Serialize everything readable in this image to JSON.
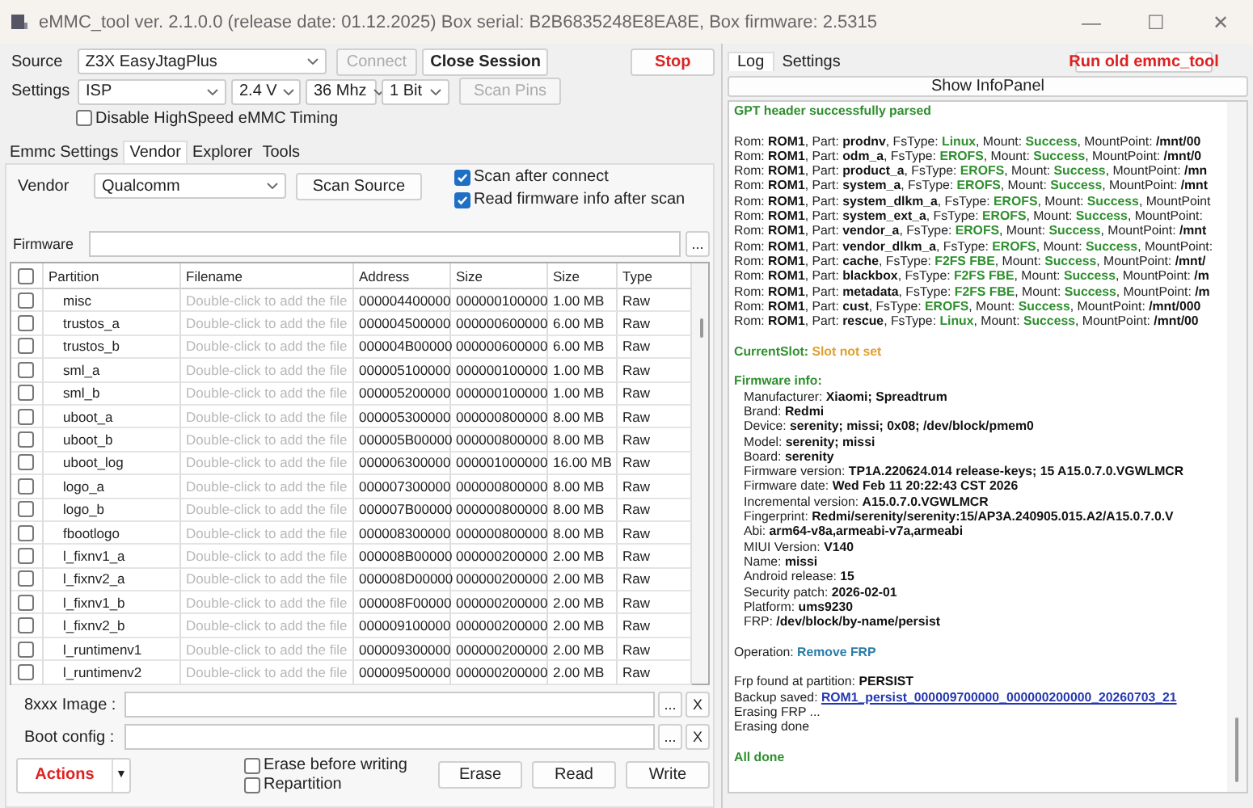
{
  "window": {
    "title": "eMMC_tool ver. 2.1.0.0 (release date: 01.12.2025) Box serial: B2B6835248E8EA8E, Box firmware: 2.5315",
    "controls": [
      "—",
      "☐",
      "✕"
    ]
  },
  "source": {
    "label": "Source",
    "value": "Z3X EasyJtagPlus",
    "connect": {
      "label": "Connect",
      "disabled": true
    },
    "close_session": "Close Session",
    "stop": "Stop"
  },
  "settings": {
    "label": "Settings",
    "interface": "ISP",
    "voltage": "2.4 V",
    "clock": "36 Mhz",
    "bus": "1 Bit",
    "scan_pins": {
      "label": "Scan Pins",
      "disabled": true
    }
  },
  "disable_highspeed": {
    "label": "Disable HighSpeed eMMC Timing",
    "checked": false
  },
  "tabs": [
    {
      "label": "Emmc Settings",
      "selected": false
    },
    {
      "label": "Vendor",
      "selected": true
    },
    {
      "label": "Explorer",
      "selected": false
    },
    {
      "label": "Tools",
      "selected": false
    }
  ],
  "vendor": {
    "label": "Vendor",
    "value": "Qualcomm",
    "scan_source": "Scan Source",
    "options": [
      {
        "label": "Scan after connect",
        "checked": true
      },
      {
        "label": "Read firmware info after scan",
        "checked": true
      }
    ]
  },
  "firmware": {
    "label": "Firmware",
    "browse": "..."
  },
  "table": {
    "header_checked": false,
    "columns": [
      "Partition",
      "Filename",
      "Address",
      "Size",
      "Size",
      "Type"
    ],
    "rows": [
      {
        "checked": false,
        "partition": "misc",
        "filename": "Double-click to add the file",
        "address": "000004400000",
        "size": "000000100000",
        "size_mb": "1.00 MB",
        "type": "Raw"
      },
      {
        "checked": false,
        "partition": "trustos_a",
        "filename": "Double-click to add the file",
        "address": "000004500000",
        "size": "000000600000",
        "size_mb": "6.00 MB",
        "type": "Raw"
      },
      {
        "checked": false,
        "partition": "trustos_b",
        "filename": "Double-click to add the file",
        "address": "000004B00000",
        "size": "000000600000",
        "size_mb": "6.00 MB",
        "type": "Raw"
      },
      {
        "checked": false,
        "partition": "sml_a",
        "filename": "Double-click to add the file",
        "address": "000005100000",
        "size": "000000100000",
        "size_mb": "1.00 MB",
        "type": "Raw"
      },
      {
        "checked": false,
        "partition": "sml_b",
        "filename": "Double-click to add the file",
        "address": "000005200000",
        "size": "000000100000",
        "size_mb": "1.00 MB",
        "type": "Raw"
      },
      {
        "checked": false,
        "partition": "uboot_a",
        "filename": "Double-click to add the file",
        "address": "000005300000",
        "size": "000000800000",
        "size_mb": "8.00 MB",
        "type": "Raw"
      },
      {
        "checked": false,
        "partition": "uboot_b",
        "filename": "Double-click to add the file",
        "address": "000005B00000",
        "size": "000000800000",
        "size_mb": "8.00 MB",
        "type": "Raw"
      },
      {
        "checked": false,
        "partition": "uboot_log",
        "filename": "Double-click to add the file",
        "address": "000006300000",
        "size": "000001000000",
        "size_mb": "16.00 MB",
        "type": "Raw"
      },
      {
        "checked": false,
        "partition": "logo_a",
        "filename": "Double-click to add the file",
        "address": "000007300000",
        "size": "000000800000",
        "size_mb": "8.00 MB",
        "type": "Raw"
      },
      {
        "checked": false,
        "partition": "logo_b",
        "filename": "Double-click to add the file",
        "address": "000007B00000",
        "size": "000000800000",
        "size_mb": "8.00 MB",
        "type": "Raw"
      },
      {
        "checked": false,
        "partition": "fbootlogo",
        "filename": "Double-click to add the file",
        "address": "000008300000",
        "size": "000000800000",
        "size_mb": "8.00 MB",
        "type": "Raw"
      },
      {
        "checked": false,
        "partition": "l_fixnv1_a",
        "filename": "Double-click to add the file",
        "address": "000008B00000",
        "size": "000000200000",
        "size_mb": "2.00 MB",
        "type": "Raw"
      },
      {
        "checked": false,
        "partition": "l_fixnv2_a",
        "filename": "Double-click to add the file",
        "address": "000008D00000",
        "size": "000000200000",
        "size_mb": "2.00 MB",
        "type": "Raw"
      },
      {
        "checked": false,
        "partition": "l_fixnv1_b",
        "filename": "Double-click to add the file",
        "address": "000008F00000",
        "size": "000000200000",
        "size_mb": "2.00 MB",
        "type": "Raw"
      },
      {
        "checked": false,
        "partition": "l_fixnv2_b",
        "filename": "Double-click to add the file",
        "address": "000009100000",
        "size": "000000200000",
        "size_mb": "2.00 MB",
        "type": "Raw"
      },
      {
        "checked": false,
        "partition": "l_runtimenv1",
        "filename": "Double-click to add the file",
        "address": "000009300000",
        "size": "000000200000",
        "size_mb": "2.00 MB",
        "type": "Raw"
      },
      {
        "checked": false,
        "partition": "l_runtimenv2",
        "filename": "Double-click to add the file",
        "address": "000009500000",
        "size": "000000200000",
        "size_mb": "2.00 MB",
        "type": "Raw"
      }
    ]
  },
  "image_fields": [
    {
      "label": "8xxx Image :",
      "browse": "...",
      "clear": "X"
    },
    {
      "label": "Boot config :",
      "browse": "...",
      "clear": "X"
    }
  ],
  "actions": {
    "label": "Actions",
    "menu": "▼",
    "options": [
      {
        "label": "Erase before writing",
        "checked": false
      },
      {
        "label": "Repartition",
        "checked": false
      }
    ],
    "buttons": [
      "Erase",
      "Read",
      "Write"
    ]
  },
  "right_tabs": [
    {
      "label": "Log",
      "selected": true
    },
    {
      "label": "Settings",
      "selected": false
    }
  ],
  "run_old": "Run old emmc_tool",
  "show_infopanel": "Show InfoPanel",
  "log": [
    {
      "kind": "line",
      "parts": [
        {
          "kind": "status",
          "text": "GPT header successfully parsed"
        }
      ]
    },
    {
      "kind": "gap"
    },
    {
      "kind": "line",
      "parts": [
        {
          "kind": "text",
          "text": "Rom: "
        },
        {
          "kind": "value",
          "text": "ROM1"
        },
        {
          "kind": "text",
          "text": ", Part: "
        },
        {
          "kind": "value",
          "text": "prodnv"
        },
        {
          "kind": "text",
          "text": ", FsType: "
        },
        {
          "kind": "status",
          "text": "Linux"
        },
        {
          "kind": "text",
          "text": ", Mount: "
        },
        {
          "kind": "status",
          "text": "Success"
        },
        {
          "kind": "text",
          "text": ", MountPoint: "
        },
        {
          "kind": "value",
          "text": "/mnt/00"
        }
      ]
    },
    {
      "kind": "line",
      "parts": [
        {
          "kind": "text",
          "text": "Rom: "
        },
        {
          "kind": "value",
          "text": "ROM1"
        },
        {
          "kind": "text",
          "text": ", Part: "
        },
        {
          "kind": "value",
          "text": "odm_a"
        },
        {
          "kind": "text",
          "text": ", FsType: "
        },
        {
          "kind": "status",
          "text": "EROFS"
        },
        {
          "kind": "text",
          "text": ", Mount: "
        },
        {
          "kind": "status",
          "text": "Success"
        },
        {
          "kind": "text",
          "text": ", MountPoint: "
        },
        {
          "kind": "value",
          "text": "/mnt/0"
        }
      ]
    },
    {
      "kind": "line",
      "parts": [
        {
          "kind": "text",
          "text": "Rom: "
        },
        {
          "kind": "value",
          "text": "ROM1"
        },
        {
          "kind": "text",
          "text": ", Part: "
        },
        {
          "kind": "value",
          "text": "product_a"
        },
        {
          "kind": "text",
          "text": ", FsType: "
        },
        {
          "kind": "status",
          "text": "EROFS"
        },
        {
          "kind": "text",
          "text": ", Mount: "
        },
        {
          "kind": "status",
          "text": "Success"
        },
        {
          "kind": "text",
          "text": ", MountPoint: "
        },
        {
          "kind": "value",
          "text": "/mn"
        }
      ]
    },
    {
      "kind": "line",
      "parts": [
        {
          "kind": "text",
          "text": "Rom: "
        },
        {
          "kind": "value",
          "text": "ROM1"
        },
        {
          "kind": "text",
          "text": ", Part: "
        },
        {
          "kind": "value",
          "text": "system_a"
        },
        {
          "kind": "text",
          "text": ", FsType: "
        },
        {
          "kind": "status",
          "text": "EROFS"
        },
        {
          "kind": "text",
          "text": ", Mount: "
        },
        {
          "kind": "status",
          "text": "Success"
        },
        {
          "kind": "text",
          "text": ", MountPoint: "
        },
        {
          "kind": "value",
          "text": "/mnt"
        }
      ]
    },
    {
      "kind": "line",
      "parts": [
        {
          "kind": "text",
          "text": "Rom: "
        },
        {
          "kind": "value",
          "text": "ROM1"
        },
        {
          "kind": "text",
          "text": ", Part: "
        },
        {
          "kind": "value",
          "text": "system_dlkm_a"
        },
        {
          "kind": "text",
          "text": ", FsType: "
        },
        {
          "kind": "status",
          "text": "EROFS"
        },
        {
          "kind": "text",
          "text": ", Mount: "
        },
        {
          "kind": "status",
          "text": "Success"
        },
        {
          "kind": "text",
          "text": ", MountPoint"
        }
      ]
    },
    {
      "kind": "line",
      "parts": [
        {
          "kind": "text",
          "text": "Rom: "
        },
        {
          "kind": "value",
          "text": "ROM1"
        },
        {
          "kind": "text",
          "text": ", Part: "
        },
        {
          "kind": "value",
          "text": "system_ext_a"
        },
        {
          "kind": "text",
          "text": ", FsType: "
        },
        {
          "kind": "status",
          "text": "EROFS"
        },
        {
          "kind": "text",
          "text": ", Mount: "
        },
        {
          "kind": "status",
          "text": "Success"
        },
        {
          "kind": "text",
          "text": ", MountPoint:"
        }
      ]
    },
    {
      "kind": "line",
      "parts": [
        {
          "kind": "text",
          "text": "Rom: "
        },
        {
          "kind": "value",
          "text": "ROM1"
        },
        {
          "kind": "text",
          "text": ", Part: "
        },
        {
          "kind": "value",
          "text": "vendor_a"
        },
        {
          "kind": "text",
          "text": ", FsType: "
        },
        {
          "kind": "status",
          "text": "EROFS"
        },
        {
          "kind": "text",
          "text": ", Mount: "
        },
        {
          "kind": "status",
          "text": "Success"
        },
        {
          "kind": "text",
          "text": ", MountPoint: "
        },
        {
          "kind": "value",
          "text": "/mnt"
        }
      ]
    },
    {
      "kind": "line",
      "parts": [
        {
          "kind": "text",
          "text": "Rom: "
        },
        {
          "kind": "value",
          "text": "ROM1"
        },
        {
          "kind": "text",
          "text": ", Part: "
        },
        {
          "kind": "value",
          "text": "vendor_dlkm_a"
        },
        {
          "kind": "text",
          "text": ", FsType: "
        },
        {
          "kind": "status",
          "text": "EROFS"
        },
        {
          "kind": "text",
          "text": ", Mount: "
        },
        {
          "kind": "status",
          "text": "Success"
        },
        {
          "kind": "text",
          "text": ", MountPoint:"
        }
      ]
    },
    {
      "kind": "line",
      "parts": [
        {
          "kind": "text",
          "text": "Rom: "
        },
        {
          "kind": "value",
          "text": "ROM1"
        },
        {
          "kind": "text",
          "text": ", Part: "
        },
        {
          "kind": "value",
          "text": "cache"
        },
        {
          "kind": "text",
          "text": ", FsType: "
        },
        {
          "kind": "status",
          "text": "F2FS FBE"
        },
        {
          "kind": "text",
          "text": ", Mount: "
        },
        {
          "kind": "status",
          "text": "Success"
        },
        {
          "kind": "text",
          "text": ", MountPoint: "
        },
        {
          "kind": "value",
          "text": "/mnt/"
        }
      ]
    },
    {
      "kind": "line",
      "parts": [
        {
          "kind": "text",
          "text": "Rom: "
        },
        {
          "kind": "value",
          "text": "ROM1"
        },
        {
          "kind": "text",
          "text": ", Part: "
        },
        {
          "kind": "value",
          "text": "blackbox"
        },
        {
          "kind": "text",
          "text": ", FsType: "
        },
        {
          "kind": "status",
          "text": "F2FS FBE"
        },
        {
          "kind": "text",
          "text": ", Mount: "
        },
        {
          "kind": "status",
          "text": "Success"
        },
        {
          "kind": "text",
          "text": ", MountPoint: "
        },
        {
          "kind": "value",
          "text": "/m"
        }
      ]
    },
    {
      "kind": "line",
      "parts": [
        {
          "kind": "text",
          "text": "Rom: "
        },
        {
          "kind": "value",
          "text": "ROM1"
        },
        {
          "kind": "text",
          "text": ", Part: "
        },
        {
          "kind": "value",
          "text": "metadata"
        },
        {
          "kind": "text",
          "text": ", FsType: "
        },
        {
          "kind": "status",
          "text": "F2FS FBE"
        },
        {
          "kind": "text",
          "text": ", Mount: "
        },
        {
          "kind": "status",
          "text": "Success"
        },
        {
          "kind": "text",
          "text": ", MountPoint: "
        },
        {
          "kind": "value",
          "text": "/m"
        }
      ]
    },
    {
      "kind": "line",
      "parts": [
        {
          "kind": "text",
          "text": "Rom: "
        },
        {
          "kind": "value",
          "text": "ROM1"
        },
        {
          "kind": "text",
          "text": ", Part: "
        },
        {
          "kind": "value",
          "text": "cust"
        },
        {
          "kind": "text",
          "text": ", FsType: "
        },
        {
          "kind": "status",
          "text": "EROFS"
        },
        {
          "kind": "text",
          "text": ", Mount: "
        },
        {
          "kind": "status",
          "text": "Success"
        },
        {
          "kind": "text",
          "text": ", MountPoint: "
        },
        {
          "kind": "value",
          "text": "/mnt/000"
        }
      ]
    },
    {
      "kind": "line",
      "parts": [
        {
          "kind": "text",
          "text": "Rom: "
        },
        {
          "kind": "value",
          "text": "ROM1"
        },
        {
          "kind": "text",
          "text": ", Part: "
        },
        {
          "kind": "value",
          "text": "rescue"
        },
        {
          "kind": "text",
          "text": ", FsType: "
        },
        {
          "kind": "status",
          "text": "Linux"
        },
        {
          "kind": "text",
          "text": ", Mount: "
        },
        {
          "kind": "status",
          "text": "Success"
        },
        {
          "kind": "text",
          "text": ", MountPoint: "
        },
        {
          "kind": "value",
          "text": "/mnt/00"
        }
      ]
    },
    {
      "kind": "gap"
    },
    {
      "kind": "line",
      "parts": [
        {
          "kind": "status",
          "text": "CurrentSlot: "
        },
        {
          "kind": "warning",
          "text": "Slot not set"
        }
      ]
    },
    {
      "kind": "gap"
    },
    {
      "kind": "line",
      "parts": [
        {
          "kind": "status",
          "text": "Firmware info:"
        }
      ]
    },
    {
      "kind": "detail",
      "parts": [
        {
          "kind": "text",
          "text": "Manufacturer: "
        },
        {
          "kind": "value",
          "text": "Xiaomi;  Spreadtrum"
        }
      ]
    },
    {
      "kind": "detail",
      "parts": [
        {
          "kind": "text",
          "text": "Brand: "
        },
        {
          "kind": "value",
          "text": "Redmi"
        }
      ]
    },
    {
      "kind": "detail",
      "parts": [
        {
          "kind": "text",
          "text": "Device: "
        },
        {
          "kind": "value",
          "text": "serenity;  missi;  0x08;  /dev/block/pmem0"
        }
      ]
    },
    {
      "kind": "detail",
      "parts": [
        {
          "kind": "text",
          "text": "Model: "
        },
        {
          "kind": "value",
          "text": "serenity;  missi"
        }
      ]
    },
    {
      "kind": "detail",
      "parts": [
        {
          "kind": "text",
          "text": "Board: "
        },
        {
          "kind": "value",
          "text": "serenity"
        }
      ]
    },
    {
      "kind": "detail",
      "parts": [
        {
          "kind": "text",
          "text": "Firmware version: "
        },
        {
          "kind": "value",
          "text": "TP1A.220624.014 release-keys;  15 A15.0.7.0.VGWLMCR"
        }
      ]
    },
    {
      "kind": "detail",
      "parts": [
        {
          "kind": "text",
          "text": "Firmware date: "
        },
        {
          "kind": "value",
          "text": "Wed Feb 11 20:22:43 CST 2026"
        }
      ]
    },
    {
      "kind": "detail",
      "parts": [
        {
          "kind": "text",
          "text": "Incremental version: "
        },
        {
          "kind": "value",
          "text": "A15.0.7.0.VGWLMCR"
        }
      ]
    },
    {
      "kind": "detail",
      "parts": [
        {
          "kind": "text",
          "text": "Fingerprint: "
        },
        {
          "kind": "value",
          "text": "Redmi/serenity/serenity:15/AP3A.240905.015.A2/A15.0.7.0.V"
        }
      ]
    },
    {
      "kind": "detail",
      "parts": [
        {
          "kind": "text",
          "text": "Abi: "
        },
        {
          "kind": "value",
          "text": "arm64-v8a,armeabi-v7a,armeabi"
        }
      ]
    },
    {
      "kind": "detail",
      "parts": [
        {
          "kind": "text",
          "text": "MIUI Version: "
        },
        {
          "kind": "value",
          "text": "V140"
        }
      ]
    },
    {
      "kind": "detail",
      "parts": [
        {
          "kind": "text",
          "text": "Name: "
        },
        {
          "kind": "value",
          "text": "missi"
        }
      ]
    },
    {
      "kind": "detail",
      "parts": [
        {
          "kind": "text",
          "text": "Android release: "
        },
        {
          "kind": "value",
          "text": "15"
        }
      ]
    },
    {
      "kind": "detail",
      "parts": [
        {
          "kind": "text",
          "text": "Security patch: "
        },
        {
          "kind": "value",
          "text": "2026-02-01"
        }
      ]
    },
    {
      "kind": "detail",
      "parts": [
        {
          "kind": "text",
          "text": "Platform: "
        },
        {
          "kind": "value",
          "text": "ums9230"
        }
      ]
    },
    {
      "kind": "detail",
      "parts": [
        {
          "kind": "text",
          "text": "FRP: "
        },
        {
          "kind": "value",
          "text": "/dev/block/by-name/persist"
        }
      ]
    },
    {
      "kind": "gap"
    },
    {
      "kind": "line",
      "parts": [
        {
          "kind": "text",
          "text": "Operation: "
        },
        {
          "kind": "operation",
          "text": "Remove FRP"
        }
      ]
    },
    {
      "kind": "gap"
    },
    {
      "kind": "line",
      "parts": [
        {
          "kind": "text",
          "text": "Frp found at partition: "
        },
        {
          "kind": "value",
          "text": "PERSIST"
        }
      ]
    },
    {
      "kind": "line",
      "parts": [
        {
          "kind": "text",
          "text": "Backup saved: "
        },
        {
          "kind": "link",
          "text": "ROM1_persist_000009700000_000000200000_20260703_21"
        }
      ]
    },
    {
      "kind": "line",
      "parts": [
        {
          "kind": "text",
          "text": "Erasing FRP ..."
        }
      ]
    },
    {
      "kind": "line",
      "parts": [
        {
          "kind": "text",
          "text": "Erasing done"
        }
      ]
    },
    {
      "kind": "gap"
    },
    {
      "kind": "line",
      "parts": [
        {
          "kind": "status",
          "text": "All done"
        }
      ]
    }
  ]
}
